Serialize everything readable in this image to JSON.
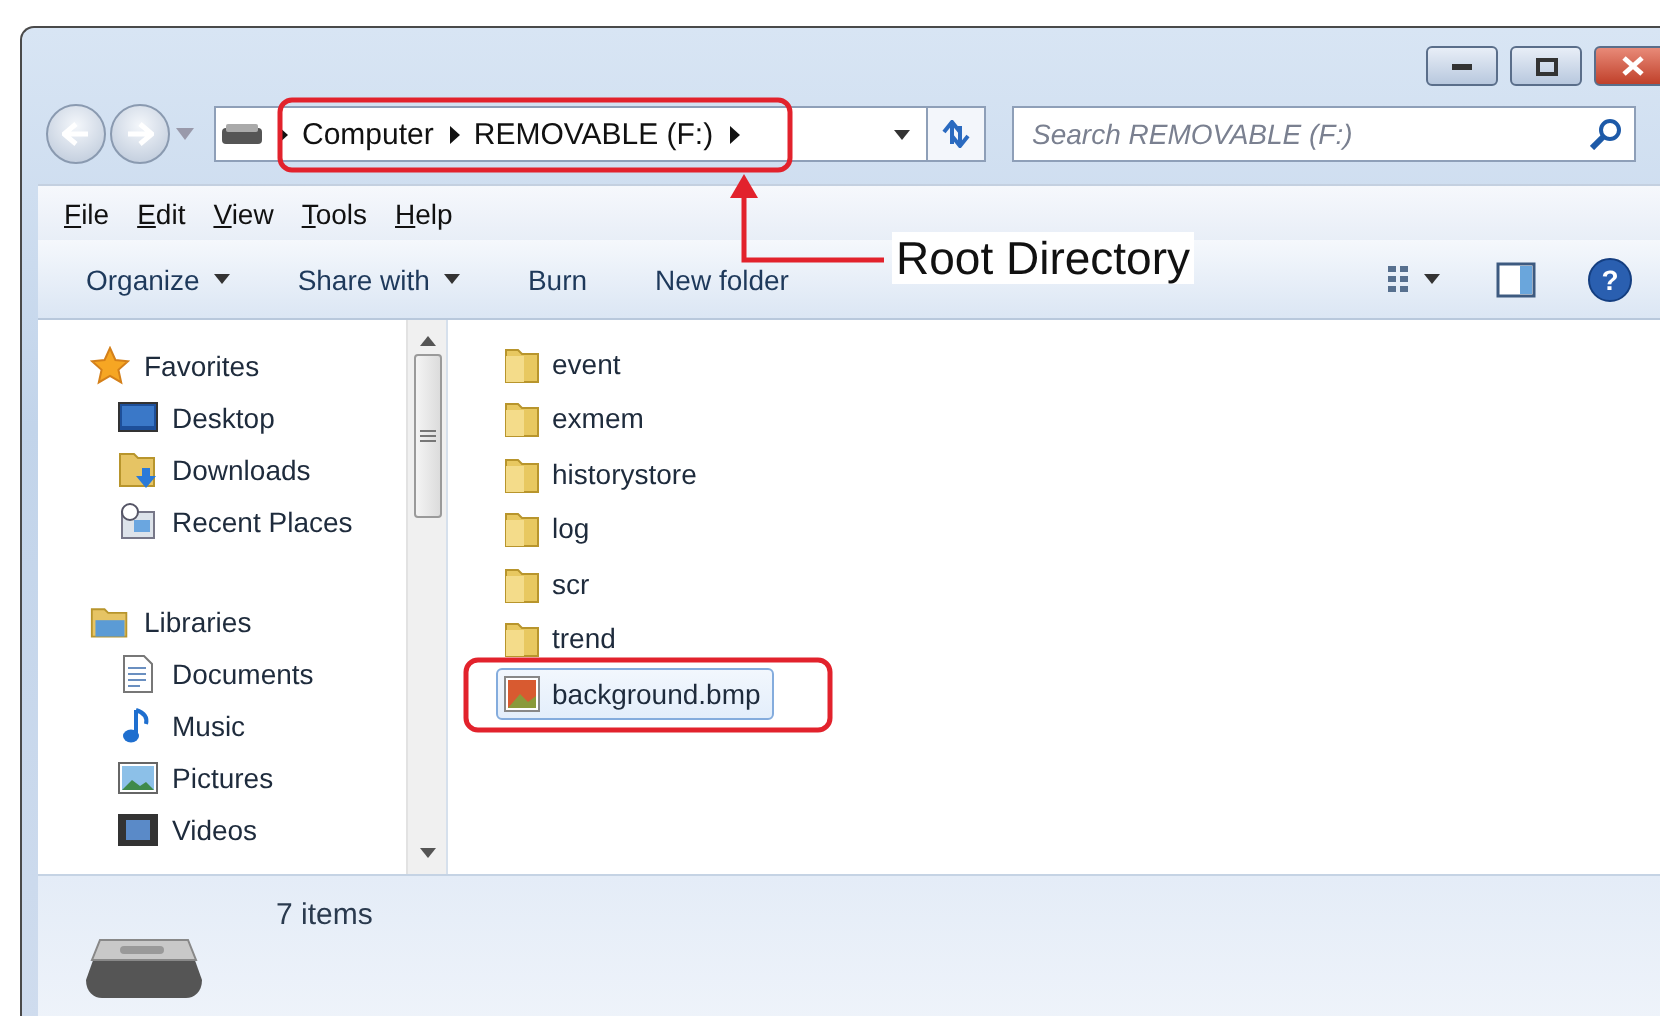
{
  "address": {
    "crumbs": [
      "Computer",
      "REMOVABLE (F:)"
    ]
  },
  "search": {
    "placeholder": "Search REMOVABLE (F:)"
  },
  "menu": [
    "File",
    "Edit",
    "View",
    "Tools",
    "Help"
  ],
  "commands": [
    {
      "label": "Organize",
      "dropdown": true
    },
    {
      "label": "Share with",
      "dropdown": true
    },
    {
      "label": "Burn",
      "dropdown": false
    },
    {
      "label": "New folder",
      "dropdown": false
    }
  ],
  "navigation": {
    "groups": [
      {
        "label": "Favorites",
        "kind": "favorites",
        "children": [
          {
            "label": "Desktop",
            "kind": "desktop"
          },
          {
            "label": "Downloads",
            "kind": "downloads"
          },
          {
            "label": "Recent Places",
            "kind": "recent"
          }
        ]
      },
      {
        "label": "Libraries",
        "kind": "libraries",
        "children": [
          {
            "label": "Documents",
            "kind": "documents"
          },
          {
            "label": "Music",
            "kind": "music"
          },
          {
            "label": "Pictures",
            "kind": "pictures"
          },
          {
            "label": "Videos",
            "kind": "videos"
          }
        ]
      }
    ]
  },
  "files": [
    {
      "name": "event",
      "kind": "folder",
      "selected": false
    },
    {
      "name": "exmem",
      "kind": "folder",
      "selected": false
    },
    {
      "name": "historystore",
      "kind": "folder",
      "selected": false
    },
    {
      "name": "log",
      "kind": "folder",
      "selected": false
    },
    {
      "name": "scr",
      "kind": "folder",
      "selected": false
    },
    {
      "name": "trend",
      "kind": "folder",
      "selected": false
    },
    {
      "name": "background.bmp",
      "kind": "image",
      "selected": true
    }
  ],
  "help_button": {
    "label": "?"
  },
  "status_bar": {
    "count": "7 items"
  },
  "annotation": {
    "label": "Root Directory"
  }
}
